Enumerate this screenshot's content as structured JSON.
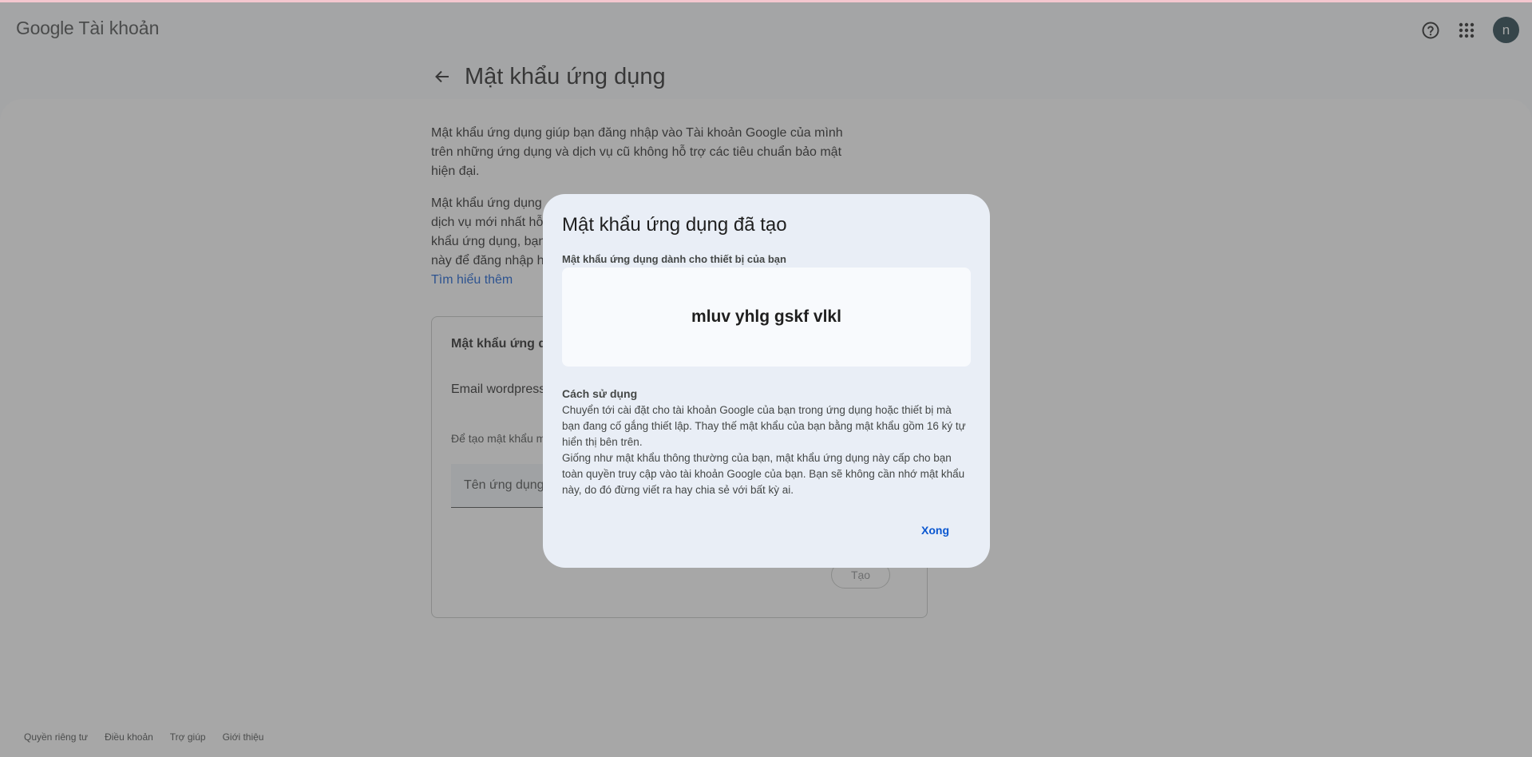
{
  "header": {
    "brand_google": "Google",
    "brand_product": "Tài khoản",
    "avatar_initial": "n"
  },
  "page": {
    "title": "Mật khẩu ứng dụng",
    "intro": "Mật khẩu ứng dụng giúp bạn đăng nhập vào Tài khoản Google của mình trên những ứng dụng và dịch vụ cũ không hỗ trợ các tiêu chuẩn bảo mật hiện đại.",
    "info_line1": "Mật khẩu ứng dụng",
    "info_line2": "dịch vụ mới nhất hỗ",
    "info_line3": "khẩu ứng dụng, bạn",
    "info_line4": "này để đăng nhập h",
    "learn_more": "Tìm hiểu thêm"
  },
  "card": {
    "title": "Mật khẩu ứng d",
    "entry": "Email wordpress",
    "hint": "Để tạo mật khẩu m dưới...",
    "input_placeholder": "Tên ứng dụng",
    "create_label": "Tạo"
  },
  "footer": {
    "privacy": "Quyền riêng tư",
    "terms": "Điều khoản",
    "help": "Trợ giúp",
    "about": "Giới thiệu"
  },
  "dialog": {
    "title": "Mật khẩu ứng dụng đã tạo",
    "subtitle": "Mật khẩu ứng dụng dành cho thiết bị của bạn",
    "password": "mluv yhlg gskf vlkl",
    "usage_title": "Cách sử dụng",
    "usage_p1": "Chuyển tới cài đặt cho tài khoản Google của bạn trong ứng dụng hoặc thiết bị mà bạn đang cố gắng thiết lập. Thay thế mật khẩu của bạn bằng mật khẩu gồm 16 ký tự hiển thị bên trên.",
    "usage_p2": "Giống như mật khẩu thông thường của bạn, mật khẩu ứng dụng này cấp cho bạn toàn quyền truy cập vào tài khoản Google của bạn. Bạn sẽ không cần nhớ mật khẩu này, do đó đừng viết ra hay chia sẻ với bất kỳ ai.",
    "done_label": "Xong"
  },
  "icons": {
    "help": "help-circle-icon",
    "apps": "apps-grid-icon",
    "back": "arrow-back-icon"
  }
}
